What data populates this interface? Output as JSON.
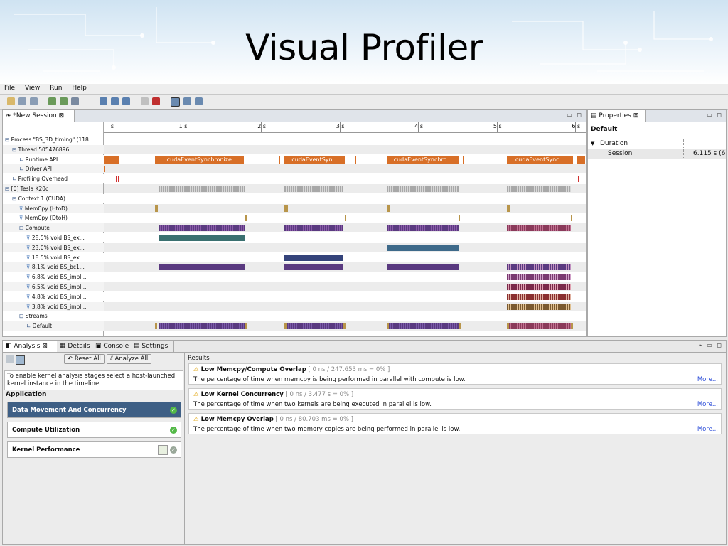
{
  "slide_title": "Visual Profiler",
  "menu": [
    "File",
    "View",
    "Run",
    "Help"
  ],
  "session_tab": "*New Session",
  "ruler_ticks": [
    "s",
    "1 s",
    "2 s",
    "3 s",
    "4 s",
    "5 s",
    "6 s"
  ],
  "timeline": {
    "duration_s": 6.115,
    "api_calls": [
      {
        "start": 0,
        "end": 0.2,
        "label": ""
      },
      {
        "start": 0.65,
        "end": 1.78,
        "label": "cudaEventSynchronize"
      },
      {
        "start": 2.3,
        "end": 3.07,
        "label": "cudaEventSyn..."
      },
      {
        "start": 3.6,
        "end": 4.52,
        "label": "cudaEventSynchro..."
      },
      {
        "start": 5.13,
        "end": 5.97,
        "label": "cudaEventSync..."
      },
      {
        "start": 6.02,
        "end": 6.12,
        "label": ""
      }
    ]
  },
  "tree_rows": [
    {
      "label": "Process \"BS_3D_timing\" (118...",
      "indent": 0,
      "icon": "collapse"
    },
    {
      "label": "Thread 505476896",
      "indent": 1,
      "icon": "collapse"
    },
    {
      "label": "Runtime API",
      "indent": 2,
      "icon": "leaf"
    },
    {
      "label": "Driver API",
      "indent": 2,
      "icon": "leaf"
    },
    {
      "label": "Profiling Overhead",
      "indent": 1,
      "icon": "leaf"
    },
    {
      "label": "[0] Tesla K20c",
      "indent": 0,
      "icon": "collapse"
    },
    {
      "label": "Context 1 (CUDA)",
      "indent": 1,
      "icon": "collapse"
    },
    {
      "label": "MemCpy (HtoD)",
      "indent": 2,
      "icon": "filter"
    },
    {
      "label": "MemCpy (DtoH)",
      "indent": 2,
      "icon": "filter"
    },
    {
      "label": "Compute",
      "indent": 2,
      "icon": "collapse"
    },
    {
      "label": "28.5% void BS_ex...",
      "indent": 3,
      "icon": "filter"
    },
    {
      "label": "23.0% void BS_ex...",
      "indent": 3,
      "icon": "filter"
    },
    {
      "label": "18.5% void BS_ex...",
      "indent": 3,
      "icon": "filter"
    },
    {
      "label": "8.1% void BS_bc1...",
      "indent": 3,
      "icon": "filter"
    },
    {
      "label": "6.8% void BS_impl...",
      "indent": 3,
      "icon": "filter"
    },
    {
      "label": "6.5% void BS_impl...",
      "indent": 3,
      "icon": "filter"
    },
    {
      "label": "4.8% void BS_impl...",
      "indent": 3,
      "icon": "filter"
    },
    {
      "label": "3.8% void BS_impl...",
      "indent": 3,
      "icon": "filter"
    },
    {
      "label": "Streams",
      "indent": 2,
      "icon": "collapse"
    },
    {
      "label": "Default",
      "indent": 3,
      "icon": "leaf"
    }
  ],
  "properties": {
    "tab": "Properties",
    "section": "Default",
    "group": "Duration",
    "row_label": "Session",
    "row_value": "6.115 s (6"
  },
  "bottom_tabs": [
    "Analysis",
    "Details",
    "Console",
    "Settings"
  ],
  "analysis": {
    "reset_button": "Reset All",
    "analyze_button": "Analyze All",
    "hint": "To enable kernel analysis stages select a host-launched kernel instance in the timeline.",
    "heading": "Application",
    "stages": [
      {
        "label": "Data Movement And Concurrency",
        "selected": true
      },
      {
        "label": "Compute Utilization",
        "selected": false
      },
      {
        "label": "Kernel Performance",
        "selected": false
      }
    ]
  },
  "results": {
    "heading": "Results",
    "more_label": "More...",
    "items": [
      {
        "title": "Low Memcpy/Compute Overlap",
        "metric": "[ 0 ns / 247.653 ms = 0% ]",
        "desc": "The percentage of time when memcpy is being performed in parallel with compute is low."
      },
      {
        "title": "Low Kernel Concurrency",
        "metric": "[ 0 ns / 3.477 s = 0% ]",
        "desc": "The percentage of time when two kernels are being executed in parallel is low."
      },
      {
        "title": "Low Memcpy Overlap",
        "metric": "[ 0 ns / 80.703 ms = 0% ]",
        "desc": "The percentage of time when two memory copies are being performed in parallel is low."
      }
    ]
  },
  "colors": {
    "api": "#d86f27",
    "kernel": "#5a3a80",
    "kernel_teal": "#3a7070",
    "kernel_navy": "#34437a",
    "memcpy": "#b8954a",
    "selected_stage": "#3e5f85"
  }
}
